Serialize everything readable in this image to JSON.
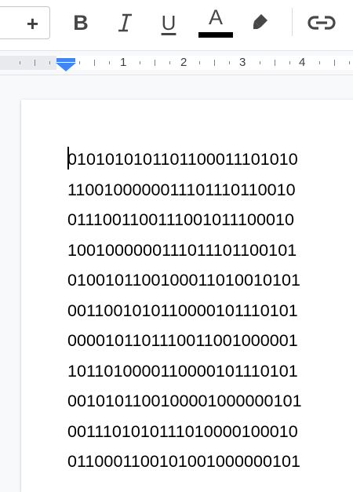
{
  "toolbar": {
    "plus_label": "+",
    "bold_label": "B",
    "italic_label": "I",
    "underline_label": "U",
    "text_color_label": "A",
    "text_color": "#000000",
    "icons": [
      "plus-icon",
      "bold-icon",
      "italic-icon",
      "underline-icon",
      "text-color-icon",
      "highlight-icon",
      "link-icon"
    ]
  },
  "ruler": {
    "numbers": [
      "1",
      "2",
      "3",
      "4"
    ]
  },
  "document": {
    "lines": [
      "0101010101101100011101010",
      "1100100000011101110110010",
      "0111001100111001011100010",
      "1001000000111011101100101",
      "0100101100100011010010101",
      "0011001010110000101110101",
      "0000101101110011001000001",
      "1011010000110000101110101",
      "0010101100100001000000101",
      "0011101010111010000100010",
      "0110001100101001000000101"
    ]
  }
}
